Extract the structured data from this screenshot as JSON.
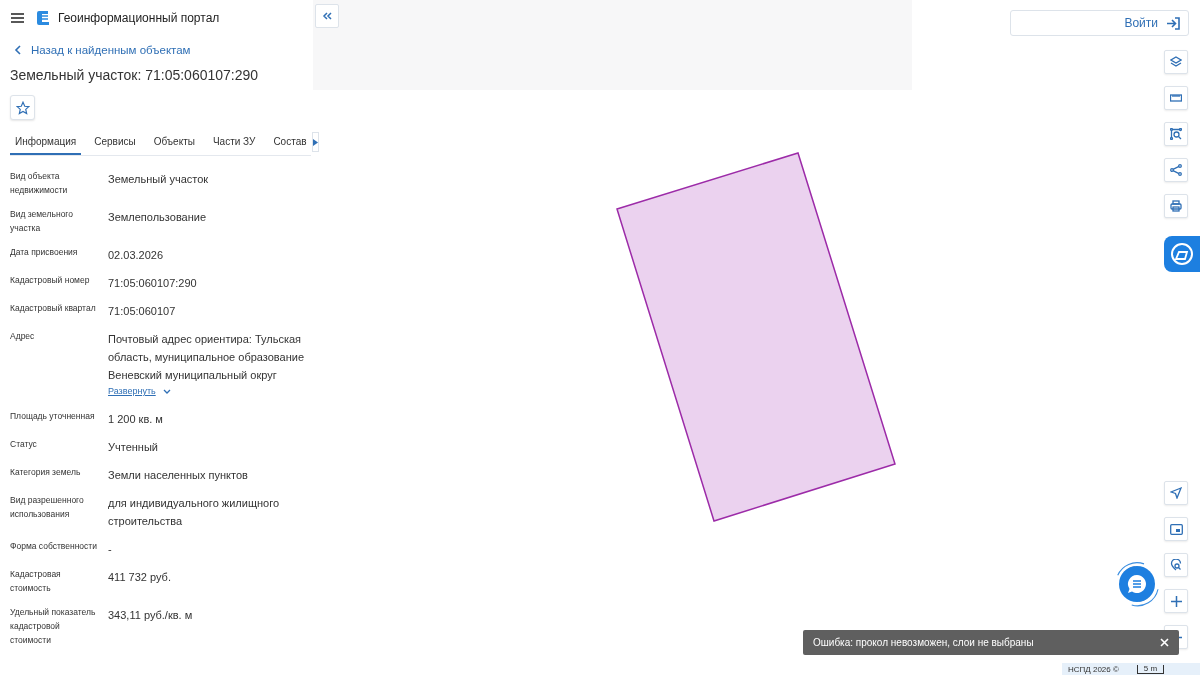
{
  "header": {
    "title": "Геоинформационный портал"
  },
  "back_link": "Назад к найденным объектам",
  "object_title": "Земельный участок: 71:05:060107:290",
  "favorite": {
    "on": false
  },
  "tabs": [
    {
      "label": "Информация",
      "selected": true
    },
    {
      "label": "Сервисы",
      "selected": false
    },
    {
      "label": "Объекты",
      "selected": false
    },
    {
      "label": "Части ЗУ",
      "selected": false
    },
    {
      "label": "Состав",
      "selected": false
    }
  ],
  "fields": [
    {
      "label": "Вид объекта недвижимости",
      "value": "Земельный участок"
    },
    {
      "label": "Вид земельного участка",
      "value": "Землепользование"
    },
    {
      "label": "Дата присвоения",
      "value": "02.03.2026"
    },
    {
      "label": "Кадастровый номер",
      "value": "71:05:060107:290"
    },
    {
      "label": "Кадастровый квартал",
      "value": "71:05:060107"
    },
    {
      "label": "Адрес",
      "value": "Почтовый адрес ориентира: Тульская область, муниципальное образование Веневский муниципальный округ",
      "expand_link": "Развернуть"
    },
    {
      "label": "Площадь уточненная",
      "value": "1 200 кв. м"
    },
    {
      "label": "Статус",
      "value": "Учтенный"
    },
    {
      "label": "Категория земель",
      "value": "Земли населенных пунктов"
    },
    {
      "label": "Вид разрешенного использования",
      "value": "для индивидуального жилищного строительства"
    },
    {
      "label": "Форма собственности",
      "value": "-"
    },
    {
      "label": "Кадастровая стоимость",
      "value": "411 732 руб."
    },
    {
      "label": "Удельный показатель кадастровой стоимости",
      "value": "343,11 руб./кв. м"
    }
  ],
  "login_button": "Войти",
  "toast": "Ошибка: прокол невозможен, слои не выбраны",
  "attribution": "НСПД 2026 ©",
  "scale": "5 m"
}
